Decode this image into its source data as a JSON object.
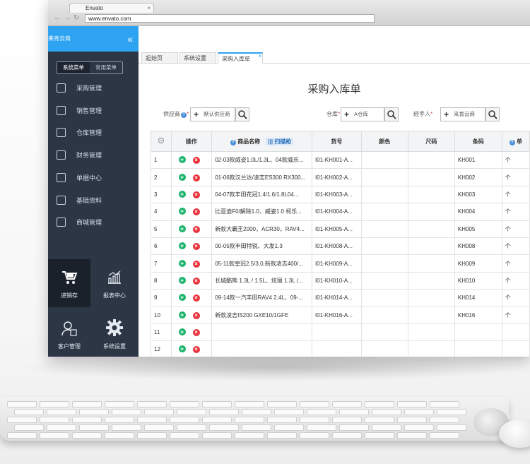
{
  "browser": {
    "tab_title": "Envato",
    "address": "www.envato.com"
  },
  "sidebar": {
    "brand": "来肯云商",
    "collapse_icon": "«",
    "menu_tabs": [
      "系统菜单",
      "常用菜单"
    ],
    "items": [
      "采购管理",
      "销售管理",
      "仓库管理",
      "财务管理",
      "单据中心",
      "基础资料",
      "商城管理"
    ],
    "bottom": [
      "进销存",
      "报表中心",
      "客户管理",
      "系统设置"
    ]
  },
  "tabs": [
    "起始页",
    "系统设置",
    "采购入库单"
  ],
  "page_title": "采购入库单",
  "filters": {
    "supplier": {
      "label": "供应商",
      "value": "默认供应商"
    },
    "warehouse": {
      "label": "仓库",
      "value": "A仓库"
    },
    "handler": {
      "label": "经手人",
      "value": "来肯云商"
    }
  },
  "table": {
    "headers": {
      "op": "操作",
      "name": "商品名称",
      "scan": "扫描枪",
      "sku": "货号",
      "color": "颜色",
      "size": "尺码",
      "barcode": "条码",
      "unit": "单"
    },
    "rows": [
      {
        "n": "1",
        "name": "02-03款威姿1.0L/1.3L、04款威乐...",
        "sku": "I01-KH001-A...",
        "barcode": "KH001",
        "unit": "个"
      },
      {
        "n": "2",
        "name": "01-06款汉兰达/凌志ES300 RX300...",
        "sku": "I01-KH002-A...",
        "barcode": "KH002",
        "unit": "个"
      },
      {
        "n": "3",
        "name": "04-07款丰田花冠1.4/1.6/1.8L04...",
        "sku": "I01-KH003-A...",
        "barcode": "KH003",
        "unit": "个"
      },
      {
        "n": "4",
        "name": "比亚迪F0/解除1.0、威姿1.0 柯乐...",
        "sku": "I01-KH004-A...",
        "barcode": "KH004",
        "unit": "个"
      },
      {
        "n": "5",
        "name": "新款大霸王2000，ACR30，RAV4...",
        "sku": "I01-KH005-A...",
        "barcode": "KH005",
        "unit": "个"
      },
      {
        "n": "6",
        "name": "00-05款丰田特锐、大发1.3",
        "sku": "I01-KH008-A...",
        "barcode": "KH008",
        "unit": "个"
      },
      {
        "n": "7",
        "name": "05-11款皇冠2.5/3.0,新款凌志400/...",
        "sku": "I01-KH009-A...",
        "barcode": "KH009",
        "unit": "个"
      },
      {
        "n": "8",
        "name": "长城酷熊 1.3L / 1.5L、炫丽 1.3L /...",
        "sku": "I01-KH010-A...",
        "barcode": "KH010",
        "unit": "个"
      },
      {
        "n": "9",
        "name": "09-14款一汽丰田RAV4 2.4L、09-...",
        "sku": "I01-KH014-A...",
        "barcode": "KH014",
        "unit": "个"
      },
      {
        "n": "10",
        "name": "新款凌志IS200 GXE10/1GFE",
        "sku": "I01-KH016-A...",
        "barcode": "KH016",
        "unit": "个"
      },
      {
        "n": "11",
        "name": "",
        "sku": "",
        "barcode": "",
        "unit": ""
      },
      {
        "n": "12",
        "name": "",
        "sku": "",
        "barcode": "",
        "unit": ""
      }
    ]
  },
  "colors": {
    "accent": "#2ea3f2",
    "sidebar": "#2c3645",
    "add": "#19b36b",
    "delete": "#e8313a"
  }
}
